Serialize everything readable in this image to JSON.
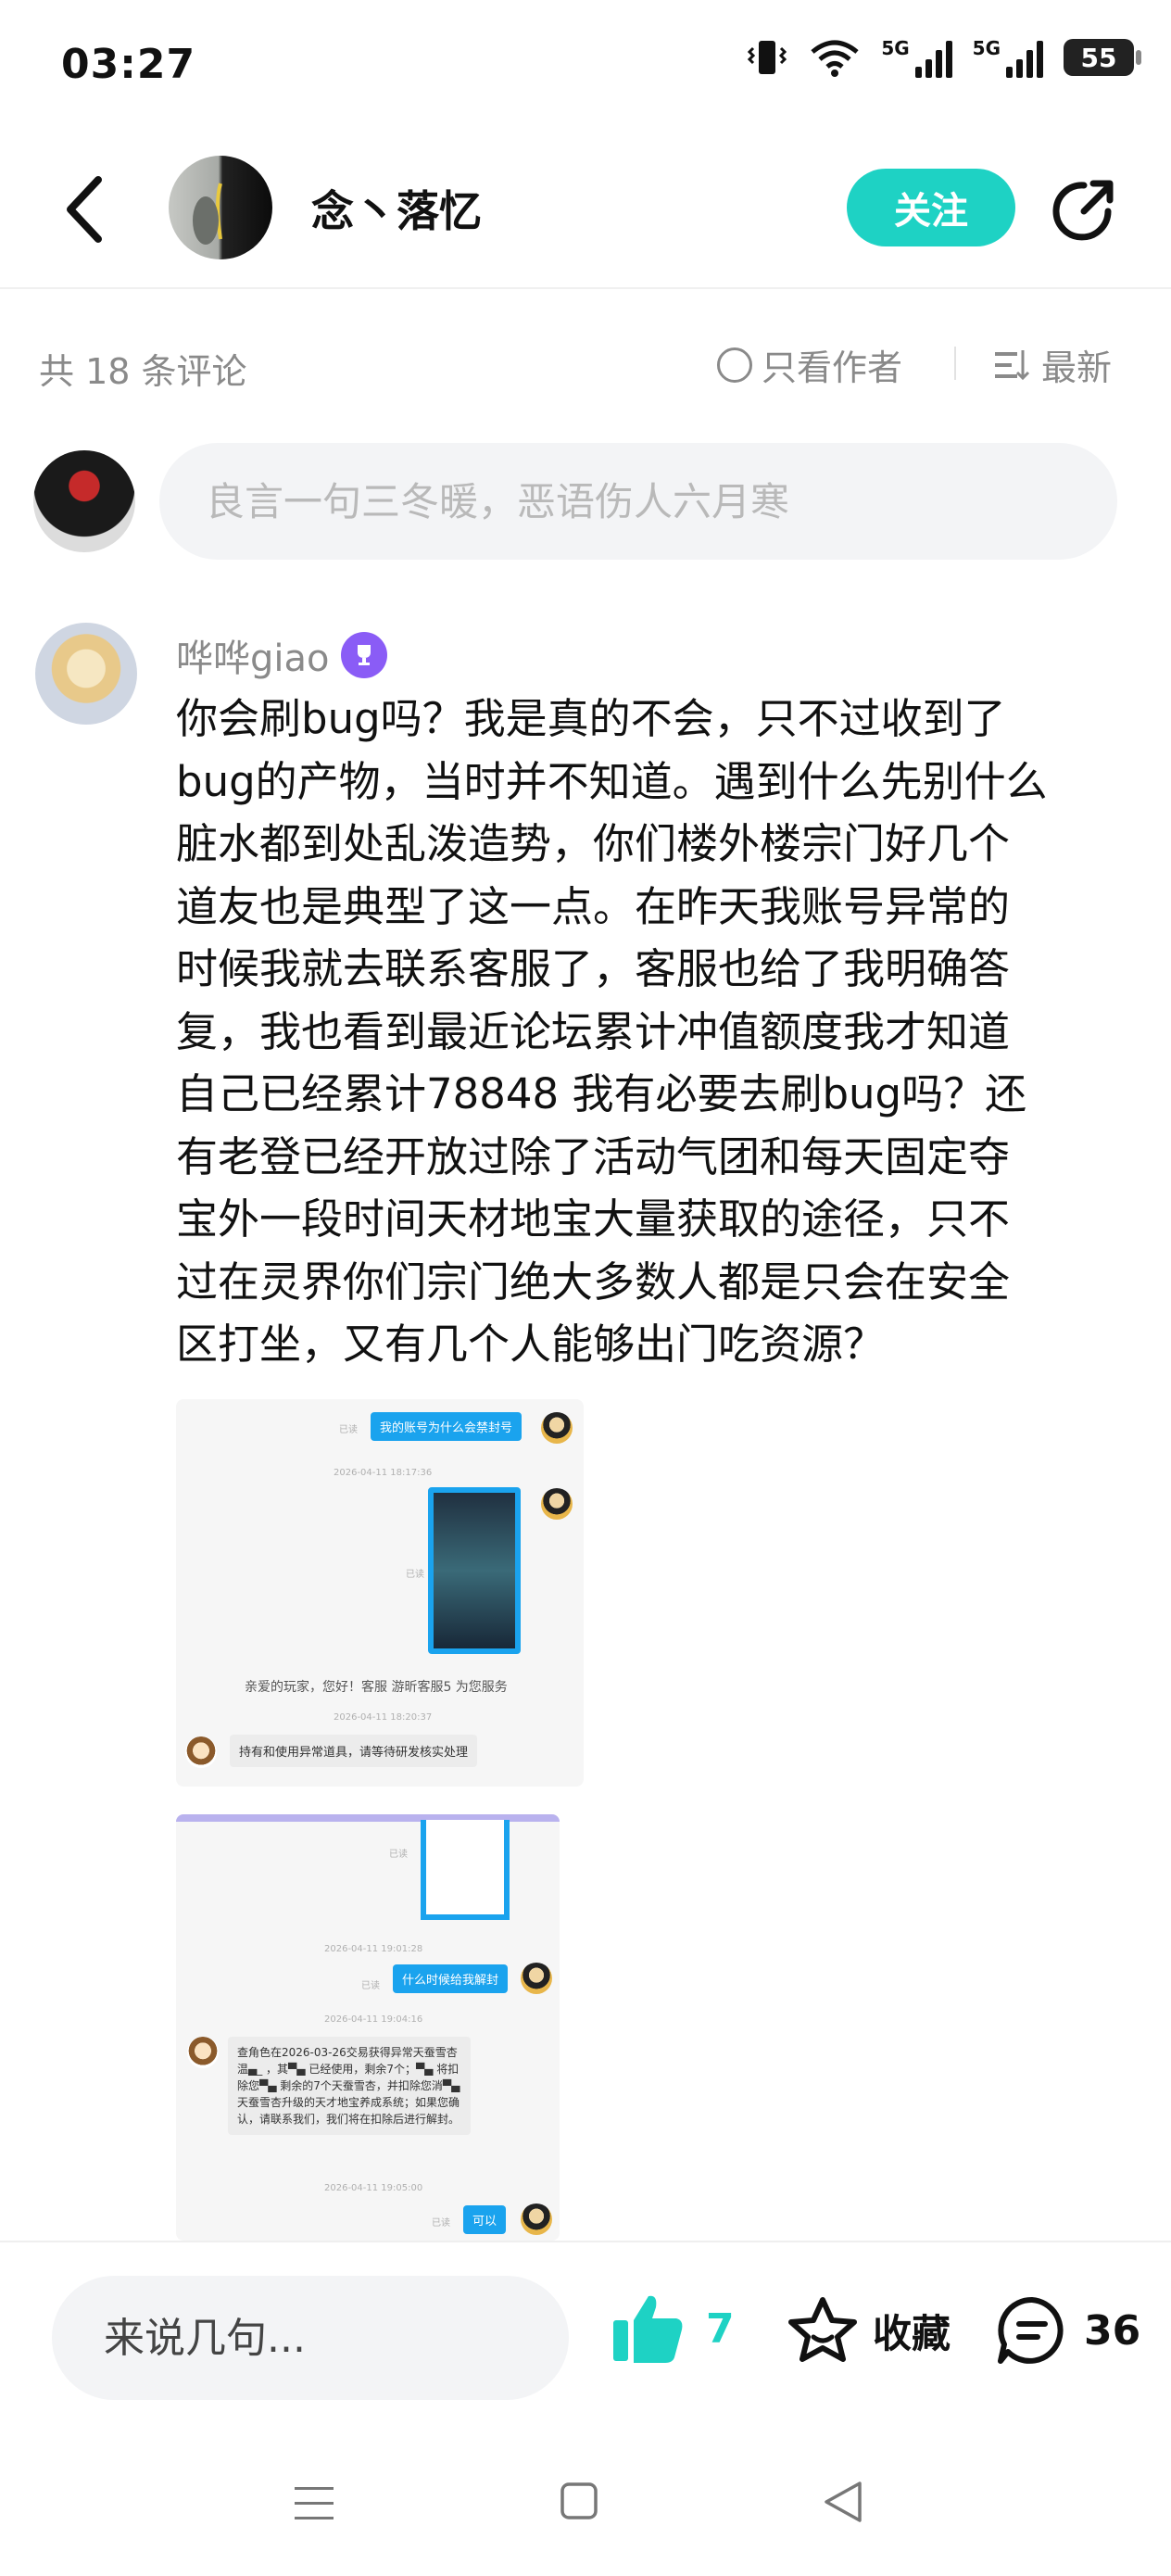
{
  "status_bar": {
    "time": "03:27",
    "net1": "5G",
    "net2": "5G",
    "battery": "55"
  },
  "header": {
    "author_name": "念丶落忆",
    "follow_label": "关注"
  },
  "comments_bar": {
    "count_text": "共 18 条评论",
    "author_only_label": "只看作者",
    "sort_label": "最新"
  },
  "comment_input": {
    "placeholder": "良言一句三冬暖，恶语伤人六月寒"
  },
  "comment": {
    "username": "哗哗giao",
    "text": "你会刷bug吗？我是真的不会，只不过收到了\nbug的产物，当时并不知道。遇到什么先别什么\n脏水都到处乱泼造势，你们楼外楼宗门好几个\n道友也是典型了这一点。在昨天我账号异常的\n时候我就去联系客服了，客服也给了我明确答\n复，我也看到最近论坛累计冲值额度我才知道\n自己已经累计78848 我有必要去刷bug吗？还\n有老登已经开放过除了活动气团和每天固定夺\n宝外一段时间天材地宝大量获取的途径，只不\n过在灵界你们宗门绝大多数人都是只会在安全\n区打坐，又有几个人能够出门吃资源？",
    "screenshot1": {
      "read1": "已读",
      "msg1": "我的账号为什么会禁封号",
      "time1": "2026-04-11 18:17:36",
      "read2": "已读",
      "system": "亲爱的玩家，您好！客服 游昕客服5 为您服务",
      "time2": "2026-04-11 18:20:37",
      "reply": "持有和使用异常道具，请等待研发核实处理"
    },
    "screenshot2": {
      "read1": "已读",
      "time1": "2026-04-11 19:01:28",
      "read2": "已读",
      "msg1": "什么时候给我解封",
      "time2": "2026-04-11 19:04:16",
      "reply": "查角色在2026-03-26交易获得异常天蚕雪杏温▄_ ，其▀▄ 已经使用，剩余7个；▀▄ 将扣除您▀▄ 剩余的7个天蚕雪杏，并扣除您消▀▄ 天蚕雪杏升级的天才地宝养成系统；如果您确认，请联系我们，我们将在扣除后进行解封。",
      "time3": "2026-04-11 19:05:00",
      "read3": "已读",
      "msg2": "可以"
    }
  },
  "bottom_bar": {
    "input_placeholder": "来说几句...",
    "like_count": "7",
    "favorite_label": "收藏",
    "comment_count": "36"
  },
  "colors": {
    "accent": "#1ed2c4",
    "chat_blue": "#1aa3ee",
    "badge_purple": "#8a5cf6"
  }
}
